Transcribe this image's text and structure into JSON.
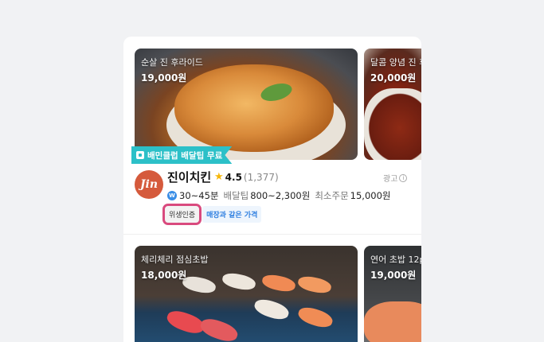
{
  "stores": [
    {
      "photos": [
        {
          "title": "순살 진 후라이드",
          "price": "19,000원"
        },
        {
          "title": "달콤 양념 진 후",
          "price": "20,000원"
        }
      ],
      "promo_badge": "배민클럽 배달팁 무료",
      "logo_text": "Jin",
      "name": "진이치킨",
      "rating": "4.5",
      "review_count": "(1,377)",
      "ad_label": "광고",
      "delivery_time": "30~45분",
      "delivery_tip_label": "배달팁",
      "delivery_tip": "800~2,300원",
      "min_order_label": "최소주문",
      "min_order": "15,000원",
      "tags": [
        "위생인증",
        "매장과 같은 가격"
      ]
    },
    {
      "photos": [
        {
          "title": "체리체리 점심초밥",
          "price": "18,000원"
        },
        {
          "title": "연어 초밥 12p",
          "price": "19,000원"
        }
      ]
    }
  ],
  "colors": {
    "badge": "#2cc0c8",
    "highlight_outline": "#d94a7e",
    "star": "#f6b70a",
    "tag_blue": "#2f7fe0"
  }
}
